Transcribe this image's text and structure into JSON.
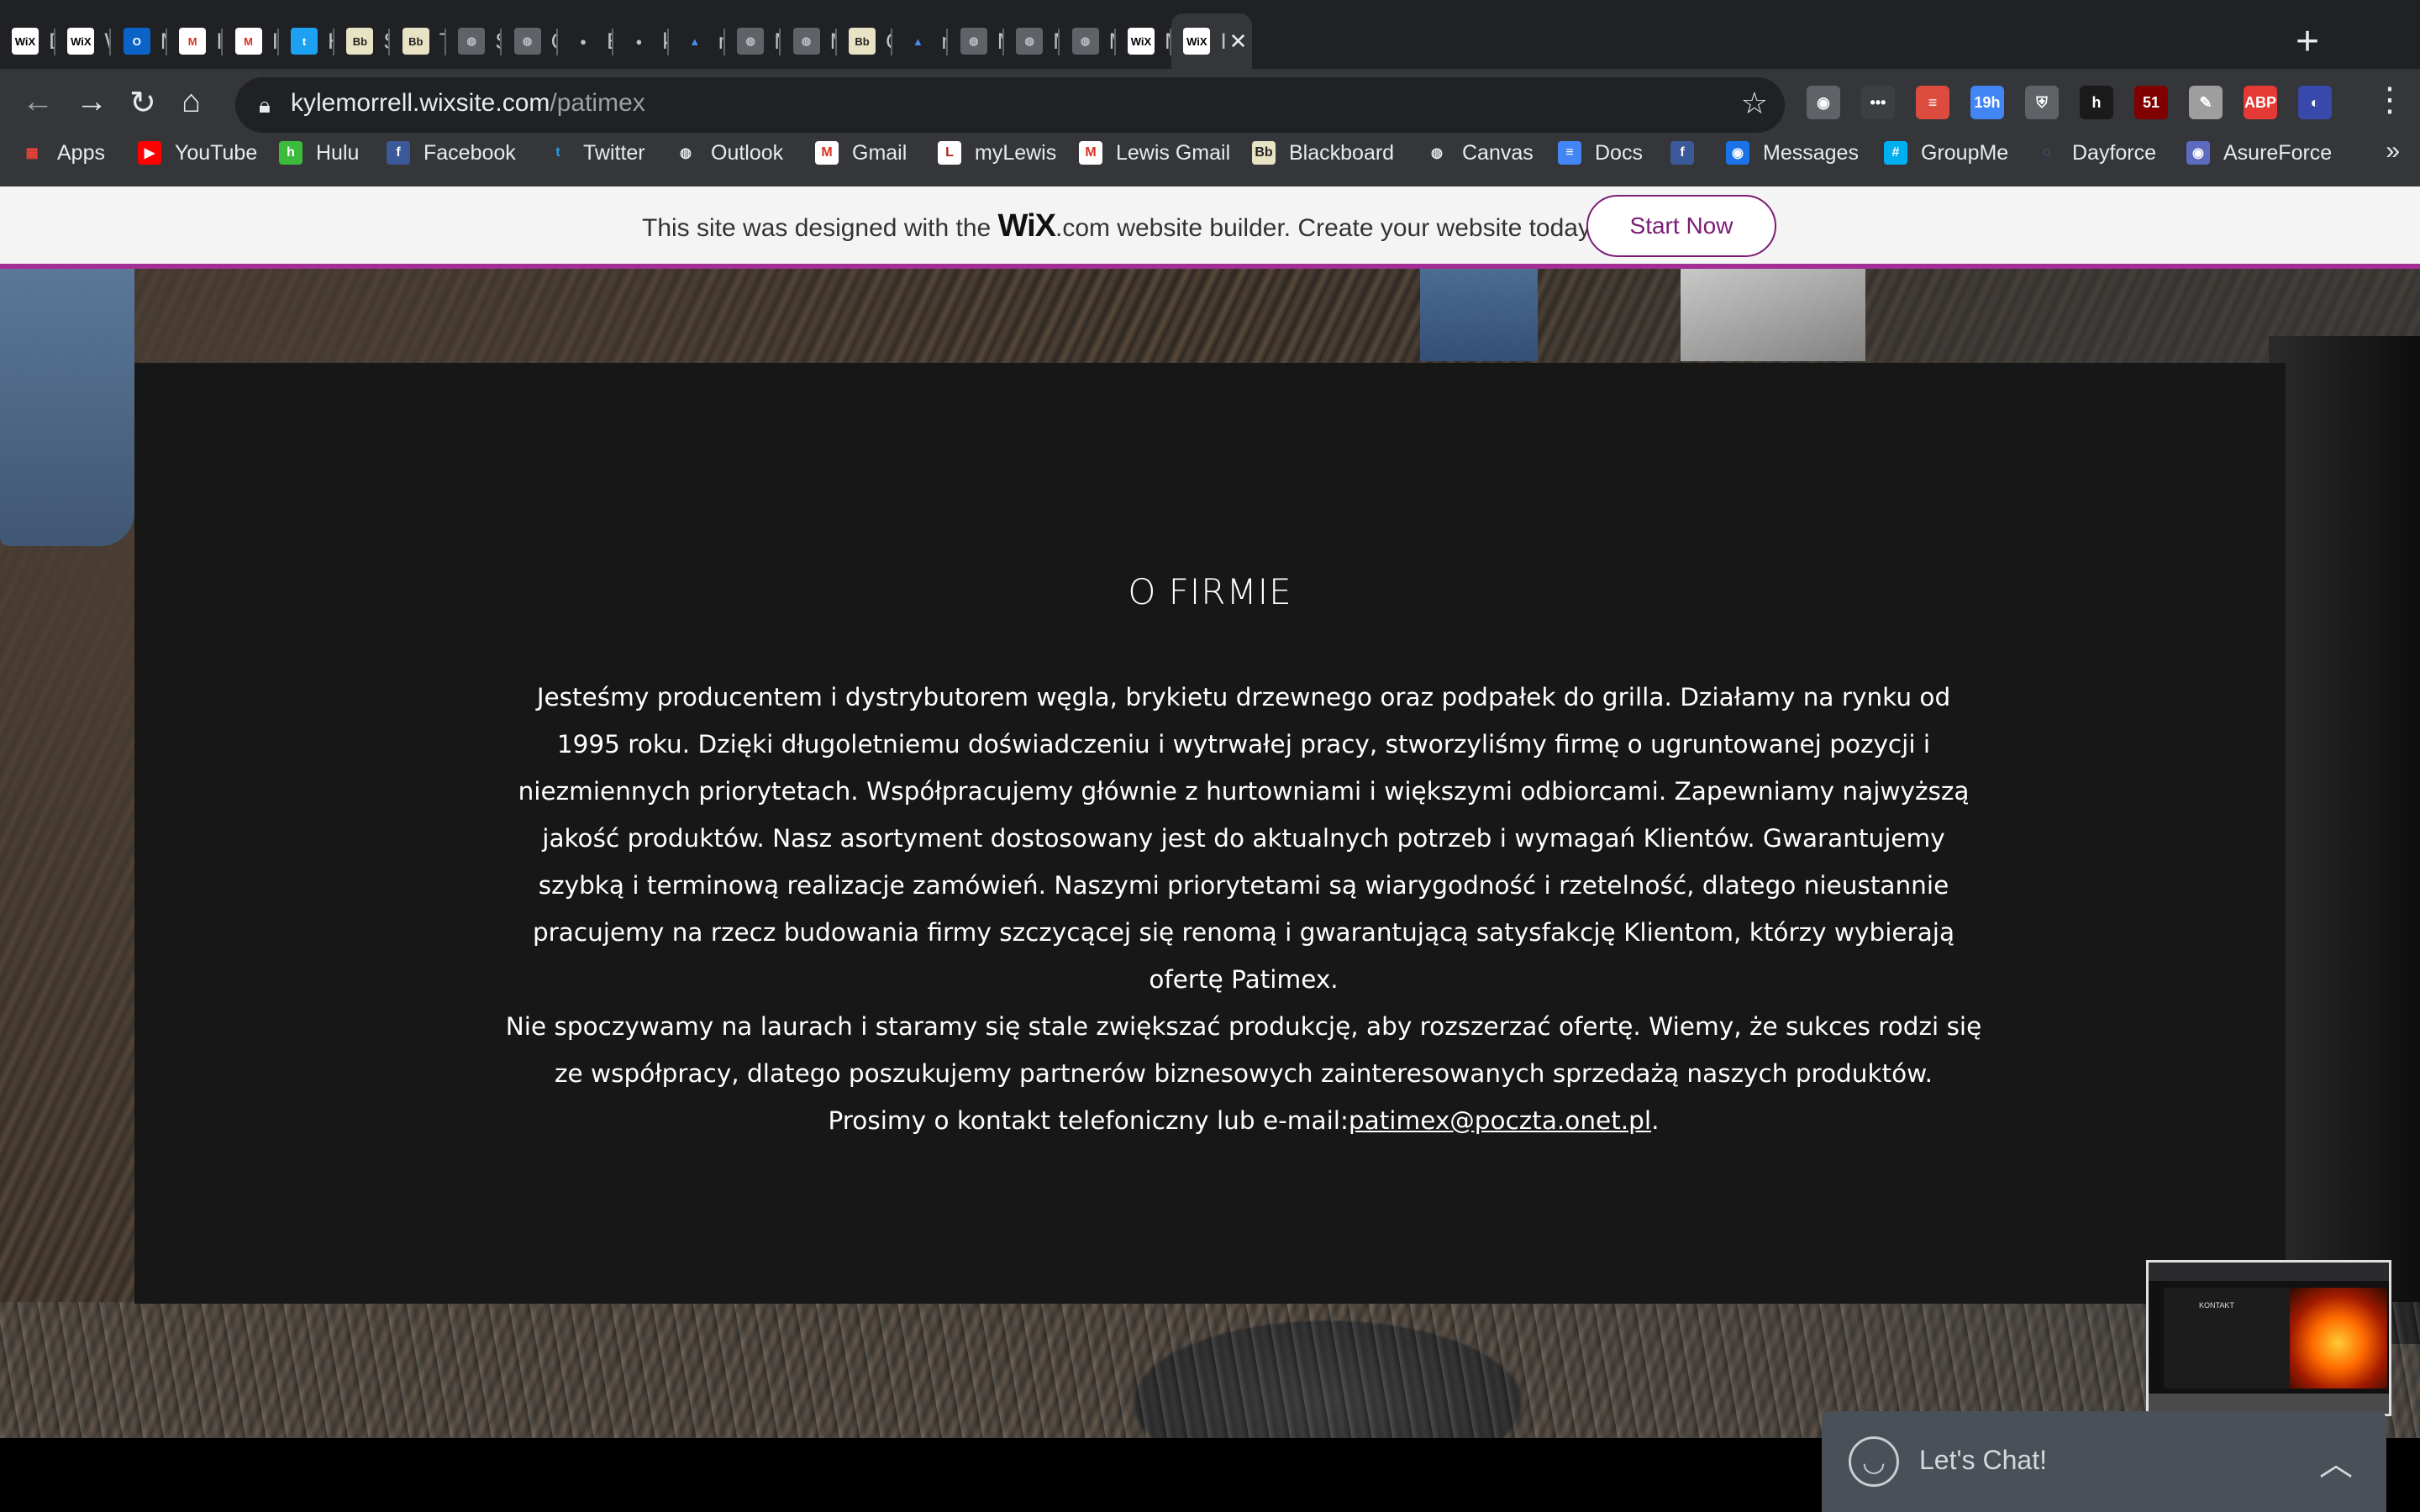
{
  "browser": {
    "tabs": [
      {
        "title": "Das",
        "favicon": "WiX",
        "fav_bg": "#ffffff",
        "fav_fg": "#000000"
      },
      {
        "title": "Wix",
        "favicon": "WiX",
        "fav_bg": "#ffffff",
        "fav_fg": "#000000"
      },
      {
        "title": "Mail",
        "favicon": "O",
        "fav_bg": "#0a64c8",
        "fav_fg": "#ffffff"
      },
      {
        "title": "Inbo",
        "favicon": "M",
        "fav_bg": "#ffffff",
        "fav_fg": "#d93025"
      },
      {
        "title": "Inbo",
        "favicon": "M",
        "fav_bg": "#ffffff",
        "fav_fg": "#d93025"
      },
      {
        "title": "Hon",
        "favicon": "t",
        "fav_bg": "#1da1f2",
        "fav_fg": "#ffffff"
      },
      {
        "title": "Spri",
        "favicon": "Bb",
        "fav_bg": "#e8e3c4",
        "fav_fg": "#222222"
      },
      {
        "title": "Take",
        "favicon": "Bb",
        "fav_bg": "#e8e3c4",
        "fav_fg": "#222222"
      },
      {
        "title": "Spri",
        "favicon": "◍",
        "fav_bg": "#5f6368",
        "fav_fg": "#bdc1c6"
      },
      {
        "title": "GitC",
        "favicon": "◍",
        "fav_bg": "#5f6368",
        "fav_fg": "#bdc1c6"
      },
      {
        "title": "Eric",
        "favicon": "●",
        "fav_bg": "#202124",
        "fav_fg": "#bdc1c6"
      },
      {
        "title": "kyle",
        "favicon": "●",
        "fav_bg": "#202124",
        "fav_fg": "#bdc1c6"
      },
      {
        "title": "mus",
        "favicon": "▲",
        "fav_bg": "#202124",
        "fav_fg": "#4a8af4"
      },
      {
        "title": "Mus",
        "favicon": "◍",
        "fav_bg": "#5f6368",
        "fav_fg": "#bdc1c6"
      },
      {
        "title": "Mus",
        "favicon": "◍",
        "fav_bg": "#5f6368",
        "fav_fg": "#bdc1c6"
      },
      {
        "title": "Con",
        "favicon": "Bb",
        "fav_bg": "#e8e3c4",
        "fav_fg": "#222222"
      },
      {
        "title": "mus",
        "favicon": "▲",
        "fav_bg": "#202124",
        "fav_fg": "#4a8af4"
      },
      {
        "title": "Mus",
        "favicon": "◍",
        "fav_bg": "#5f6368",
        "fav_fg": "#bdc1c6"
      },
      {
        "title": "Mus",
        "favicon": "◍",
        "fav_bg": "#5f6368",
        "fav_fg": "#bdc1c6"
      },
      {
        "title": "Mus",
        "favicon": "◍",
        "fav_bg": "#5f6368",
        "fav_fg": "#bdc1c6"
      },
      {
        "title": "My",
        "favicon": "WiX",
        "fav_bg": "#ffffff",
        "fav_fg": "#000000"
      },
      {
        "title": "I",
        "favicon": "WiX",
        "fav_bg": "#ffffff",
        "fav_fg": "#000000",
        "active": true
      }
    ],
    "url_host": "kylemorrell.wixsite.com",
    "url_path": "/patimex",
    "extensions": [
      {
        "name": "lightbulb-extension-icon",
        "glyph": "◉",
        "bg": "#5f6368"
      },
      {
        "name": "dots-extension-icon",
        "glyph": "•••",
        "bg": "#3c4043"
      },
      {
        "name": "todoist-extension-icon",
        "glyph": "≡",
        "bg": "#db4c3f"
      },
      {
        "name": "calendar-extension-icon",
        "glyph": "19h",
        "bg": "#4285f4"
      },
      {
        "name": "shield-extension-icon",
        "glyph": "⛨",
        "bg": "#5f6368"
      },
      {
        "name": "honey-extension-icon",
        "glyph": "h",
        "bg": "#1a1a1a"
      },
      {
        "name": "ublock-extension-icon",
        "glyph": "51",
        "bg": "#800000"
      },
      {
        "name": "evernote-extension-icon",
        "glyph": "✎",
        "bg": "#9e9e9e"
      },
      {
        "name": "adblock-extension-icon",
        "glyph": "ABP",
        "bg": "#e53935"
      },
      {
        "name": "profile-avatar-icon",
        "glyph": "◐",
        "bg": "#3949ab"
      }
    ],
    "bookmarks": [
      {
        "label": "Apps",
        "glyph": "▦",
        "bg": "transparent",
        "fg": "#ea4335"
      },
      {
        "label": "YouTube",
        "glyph": "▶",
        "bg": "#ff0000",
        "fg": "#ffffff"
      },
      {
        "label": "Hulu",
        "glyph": "h",
        "bg": "#3dbb3d",
        "fg": "#ffffff"
      },
      {
        "label": "Facebook",
        "glyph": "f",
        "bg": "#3b5998",
        "fg": "#ffffff"
      },
      {
        "label": "Twitter",
        "glyph": "t",
        "bg": "transparent",
        "fg": "#1da1f2"
      },
      {
        "label": "Outlook",
        "glyph": "◍",
        "bg": "transparent",
        "fg": "#e8eaed"
      },
      {
        "label": "Gmail",
        "glyph": "M",
        "bg": "#ffffff",
        "fg": "#d93025"
      },
      {
        "label": "myLewis",
        "glyph": "L",
        "bg": "#ffffff",
        "fg": "#b71c1c"
      },
      {
        "label": "Lewis Gmail",
        "glyph": "M",
        "bg": "#ffffff",
        "fg": "#d93025"
      },
      {
        "label": "Blackboard",
        "glyph": "Bb",
        "bg": "#e8e3c4",
        "fg": "#222222"
      },
      {
        "label": "Canvas",
        "glyph": "◍",
        "bg": "transparent",
        "fg": "#e8eaed"
      },
      {
        "label": "Docs",
        "glyph": "≡",
        "bg": "#4285f4",
        "fg": "#ffffff"
      },
      {
        "label": "",
        "glyph": "f",
        "bg": "#3b5998",
        "fg": "#ffffff"
      },
      {
        "label": "Messages",
        "glyph": "◉",
        "bg": "#1a73e8",
        "fg": "#ffffff"
      },
      {
        "label": "GroupMe",
        "glyph": "#",
        "bg": "#00aff0",
        "fg": "#ffffff"
      },
      {
        "label": "Dayforce",
        "glyph": "◌",
        "bg": "transparent",
        "fg": "#4a8af4"
      },
      {
        "label": "AsureForce",
        "glyph": "◉",
        "bg": "#5c6bc0",
        "fg": "#ffffff"
      }
    ],
    "bookmarks_more": "»"
  },
  "wix_banner": {
    "text_before": "This site was designed with the ",
    "logo": "WiX",
    "text_after": ".com website builder. Create your website today.",
    "button": "Start Now",
    "accent": "#a32f96"
  },
  "content": {
    "title": "O FIRMIE",
    "paragraph1": "Jesteśmy producentem i dystrybutorem węgla, brykietu drzewnego oraz podpałek do grilla. Działamy na rynku od 1995 roku. Dzięki długoletniemu doświadczeniu i wytrwałej pracy, stworzyliśmy firmę o ugruntowanej pozycji i niezmiennych priorytetach. Współpracujemy głównie z hurtowniami i większymi odbiorcami. Zapewniamy najwyższą jakość produktów. Nasz asortyment dostosowany jest do aktualnych potrzeb i wymagań Klientów. Gwarantujemy szybką i terminową realizacje zamówień. Naszymi priorytetami są wiarygodność i rzetelność, dlatego nieustannie pracujemy na rzecz budowania firmy szczycącej się renomą i gwarantującą satysfakcję Klientom, którzy wybierają ofertę Patimex.",
    "paragraph2": "Nie spoczywamy na laurach i staramy się stale zwiększać produkcję, aby rozszerzać ofertę. Wiemy, że sukces rodzi się ze współpracy, dlatego poszukujemy partnerów biznesowych zainteresowanych sprzedażą naszych produktów.",
    "contact_prefix": "Prosimy o kontakt telefoniczny lub e-mail:",
    "email": "patimex@poczta.onet.pl",
    "contact_suffix": "."
  },
  "thumbnail": {
    "title": "KONTAKT"
  },
  "chat": {
    "label": "Let's Chat!"
  }
}
